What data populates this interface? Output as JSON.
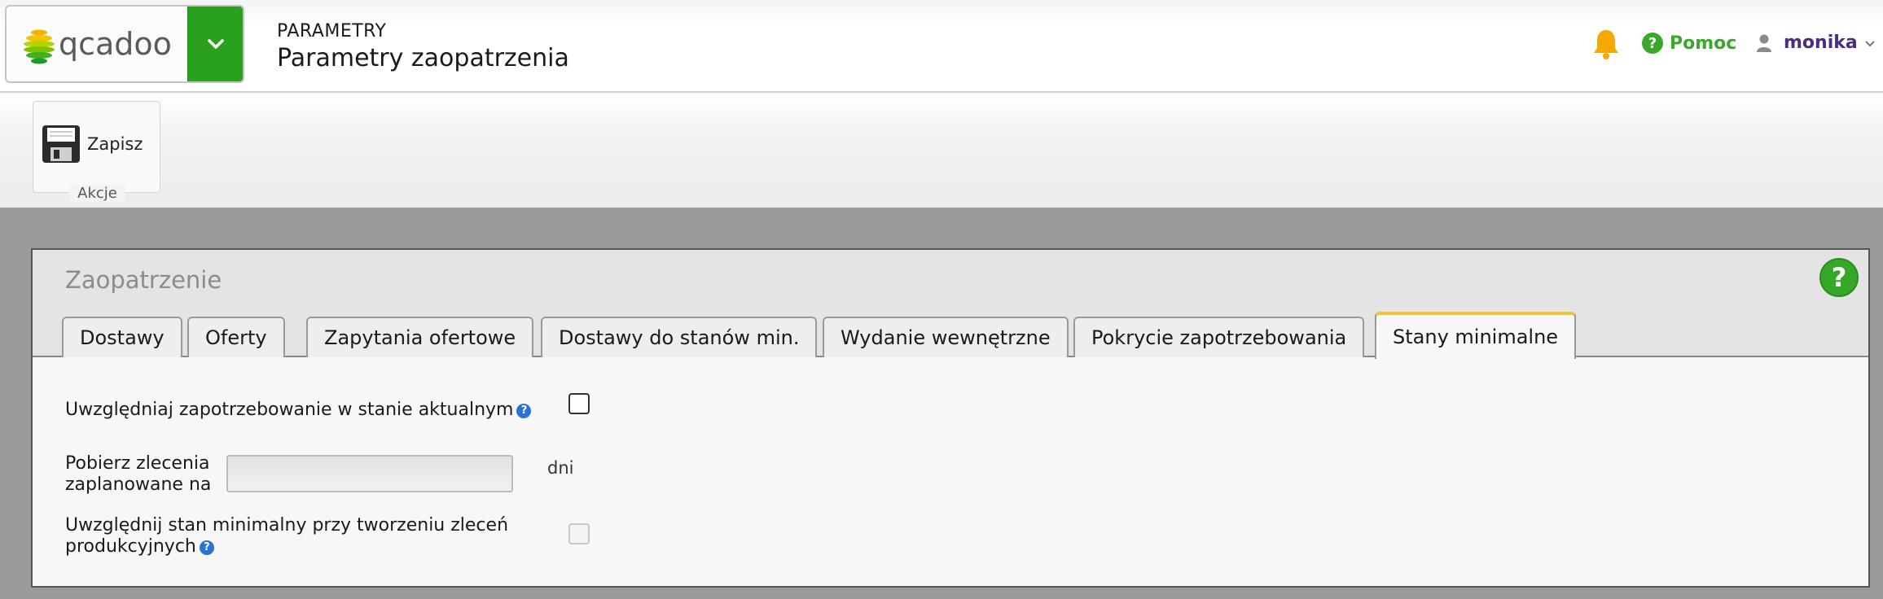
{
  "header": {
    "logo_text": "qcadoo",
    "kicker": "PARAMETRY",
    "title": "Parametry zaopatrzenia",
    "help_label": "Pomoc",
    "user_name": "monika"
  },
  "ribbon": {
    "save_label": "Zapisz",
    "group_label": "Akcje"
  },
  "panel": {
    "title": "Zaopatrzenie",
    "help_glyph": "?",
    "tabs": [
      {
        "label": "Dostawy"
      },
      {
        "label": "Oferty"
      },
      {
        "label": "Zapytania ofertowe"
      },
      {
        "label": "Dostawy do stanów min."
      },
      {
        "label": "Wydanie wewnętrzne"
      },
      {
        "label": "Pokrycie zapotrzebowania"
      },
      {
        "label": "Stany minimalne"
      }
    ],
    "active_tab": "Stany minimalne"
  },
  "form": {
    "field1_label": "Uwzględniaj zapotrzebowanie w stanie aktualnym",
    "field1_checked": false,
    "field2_label_line1": "Pobierz zlecenia",
    "field2_label_line2": "zaplanowane na",
    "field2_value": "",
    "field2_unit": "dni",
    "field3_label_line1": "Uwzględnij stan minimalny przy tworzeniu zleceń",
    "field3_label_line2": "produkcyjnych",
    "field3_checked": false,
    "info_glyph": "?"
  },
  "colors": {
    "brand_green": "#2aa11c",
    "help_green": "#3aa82b",
    "user_purple": "#4a2c83",
    "bell_orange": "#f5a800",
    "active_tab_accent": "#f1c232",
    "info_blue": "#2a72d6"
  }
}
